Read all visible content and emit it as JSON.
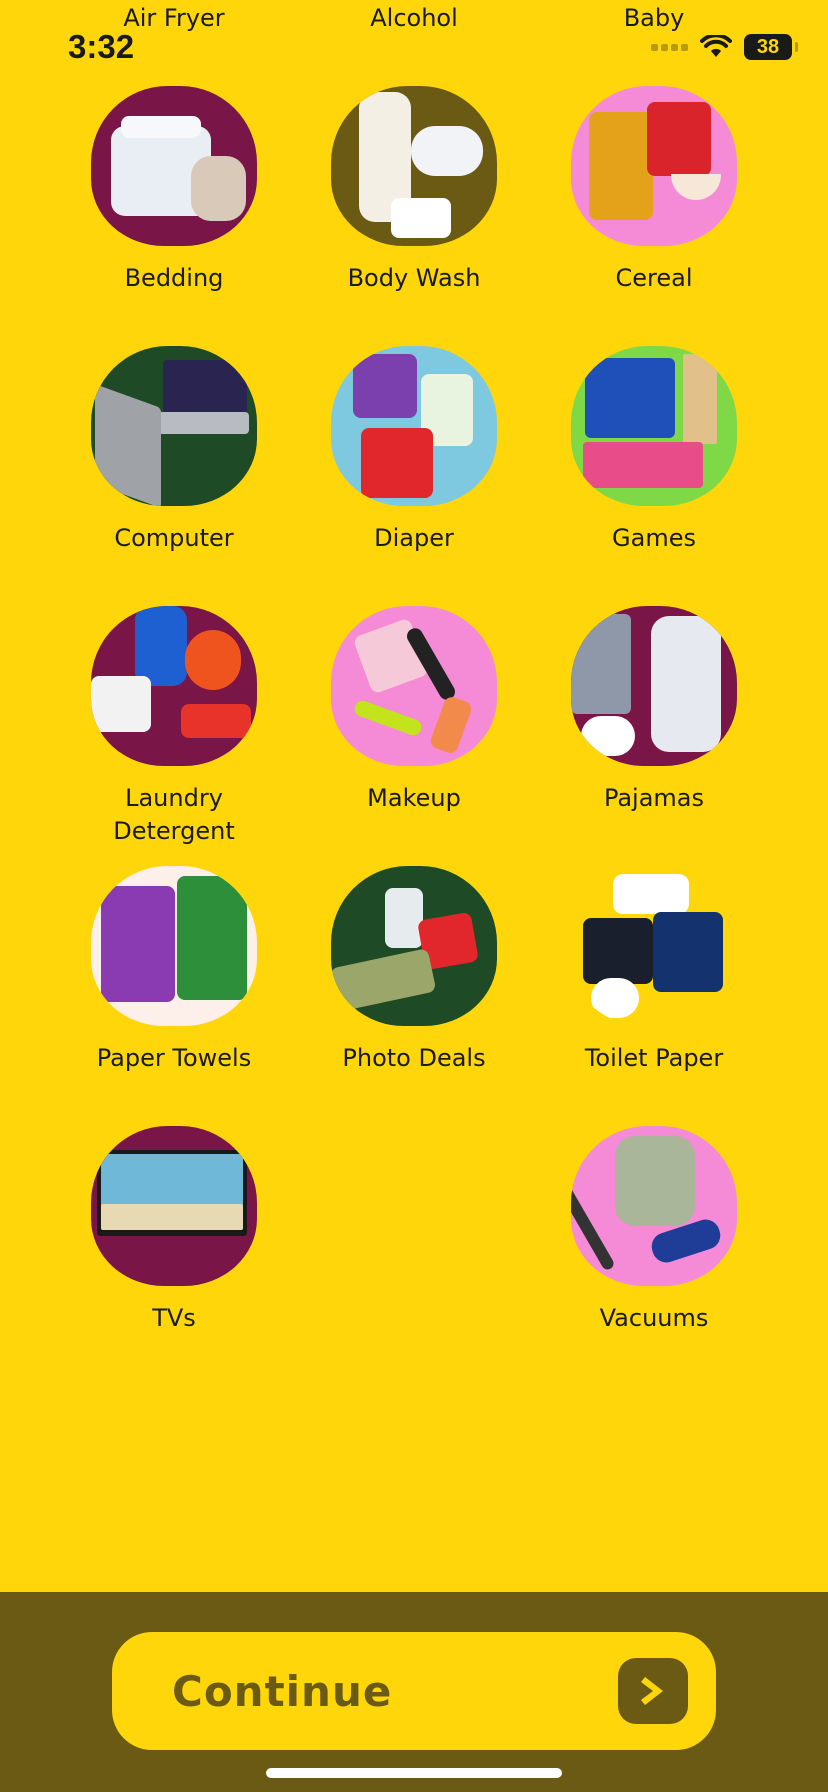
{
  "status": {
    "time": "3:32",
    "battery": "38"
  },
  "top_labels": [
    "Air Fryer",
    "Alcohol",
    "Baby"
  ],
  "categories": [
    {
      "label": "Bedding",
      "bg": "#7a1548"
    },
    {
      "label": "Body Wash",
      "bg": "#6b5a14"
    },
    {
      "label": "Cereal",
      "bg": "#f58ad6"
    },
    {
      "label": "Computer",
      "bg": "#1e4a25"
    },
    {
      "label": "Diaper",
      "bg": "#7ec8e0"
    },
    {
      "label": "Games",
      "bg": "#7fd846"
    },
    {
      "label": "Laundry\nDetergent",
      "bg": "#7a1548"
    },
    {
      "label": "Makeup",
      "bg": "#f58ad6"
    },
    {
      "label": "Pajamas",
      "bg": "#7a1548"
    },
    {
      "label": "Paper Towels",
      "bg": "#fdf0ea"
    },
    {
      "label": "Photo Deals",
      "bg": "#1e4a25"
    },
    {
      "label": "Toilet Paper",
      "bg": "#FFD60A"
    },
    {
      "label": "TVs",
      "bg": "#7a1548"
    },
    {
      "label": "Vacuums",
      "bg": "#f58ad6"
    }
  ],
  "continue": {
    "label": "Continue"
  },
  "colors": {
    "background": "#FFD60A",
    "footer": "#6b5a14"
  }
}
